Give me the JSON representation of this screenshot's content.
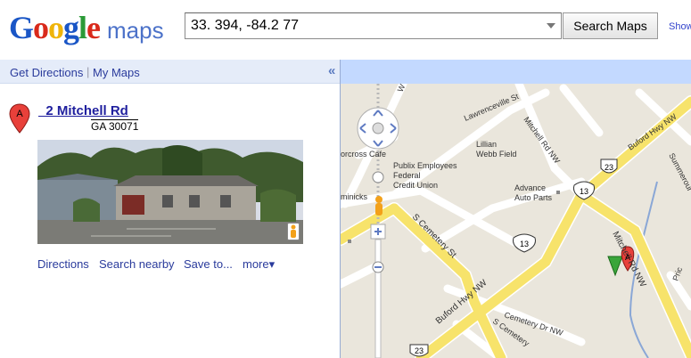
{
  "header": {
    "logo_text": "Google",
    "logo_suffix": "maps",
    "search_value": "33. 394, -84.2 77",
    "search_button": "Search Maps",
    "show_link": "Show"
  },
  "panel": {
    "get_directions": "Get Directions",
    "my_maps": "My Maps",
    "collapse_glyph": "«"
  },
  "result": {
    "marker_letter": "A",
    "title": "  2 Mitchell Rd",
    "address": "GA 30071",
    "actions": [
      "Directions",
      "Search nearby",
      "Save to...",
      "more▾"
    ]
  },
  "map": {
    "labels": {
      "lawrenceville_st": "Lawrenceville St",
      "mitchell_rd_nw_top": "Mitchell Rd NW",
      "buford_hwy_top": "Buford Hwy NW",
      "summerour": "Summerour",
      "lillian_webb": "Lillian Webb Field",
      "publix": "Publix Employees Federal Credit Union",
      "advance": "Advance Auto Parts",
      "norcross_cafe": "orcross Cafe",
      "dominicks": "minicks",
      "s_cemetery_st": "S Cemetery St",
      "buford_hwy_bottom": "Buford Hwy NW",
      "cemetery_dr": "Cemetery Dr NW",
      "s_cemetery_bottom": "S Cemetery",
      "mitchell_rd_nw_right": "Mitchell Rd NW",
      "prior": "Pric",
      "hwy13_a": "13",
      "hwy13_b": "13",
      "hwy23_a": "23",
      "hwy23_b": "23",
      "marker_a": "A",
      "w_label": "W"
    }
  }
}
